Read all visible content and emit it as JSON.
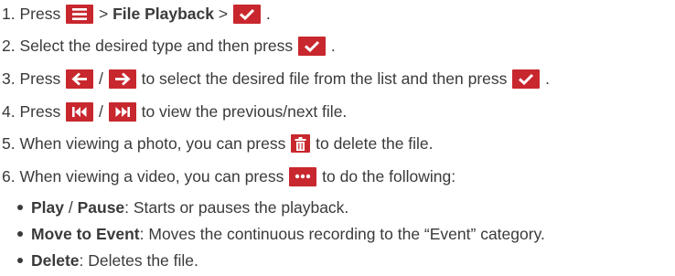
{
  "accent_color": "#c8272e",
  "steps": [
    {
      "num": "1.",
      "parts": [
        "Press",
        ">",
        "File Playback",
        ">",
        "."
      ]
    },
    {
      "num": "2.",
      "parts": [
        "Select the desired type and then press",
        "."
      ]
    },
    {
      "num": "3.",
      "parts": [
        "Press",
        "/",
        "to select the desired file from the list and then press",
        "."
      ]
    },
    {
      "num": "4.",
      "parts": [
        "Press",
        "/",
        "to view the previous/next file."
      ]
    },
    {
      "num": "5.",
      "parts": [
        "When viewing a photo, you can press",
        "to delete the file."
      ]
    },
    {
      "num": "6.",
      "parts": [
        "When viewing a video, you can press",
        "to do the following:"
      ]
    }
  ],
  "bullets": [
    {
      "term1": "Play",
      "sep": " / ",
      "term2": "Pause",
      "desc": ": Starts or pauses the playback."
    },
    {
      "term": "Move to Event",
      "desc": ": Moves the continuous recording to the “Event” category."
    },
    {
      "term": "Delete",
      "desc": ": Deletes the file."
    }
  ],
  "icons": [
    "menu-icon",
    "checkmark-icon",
    "left-arrow-icon",
    "right-arrow-icon",
    "skip-previous-icon",
    "skip-next-icon",
    "trash-icon",
    "more-icon"
  ]
}
